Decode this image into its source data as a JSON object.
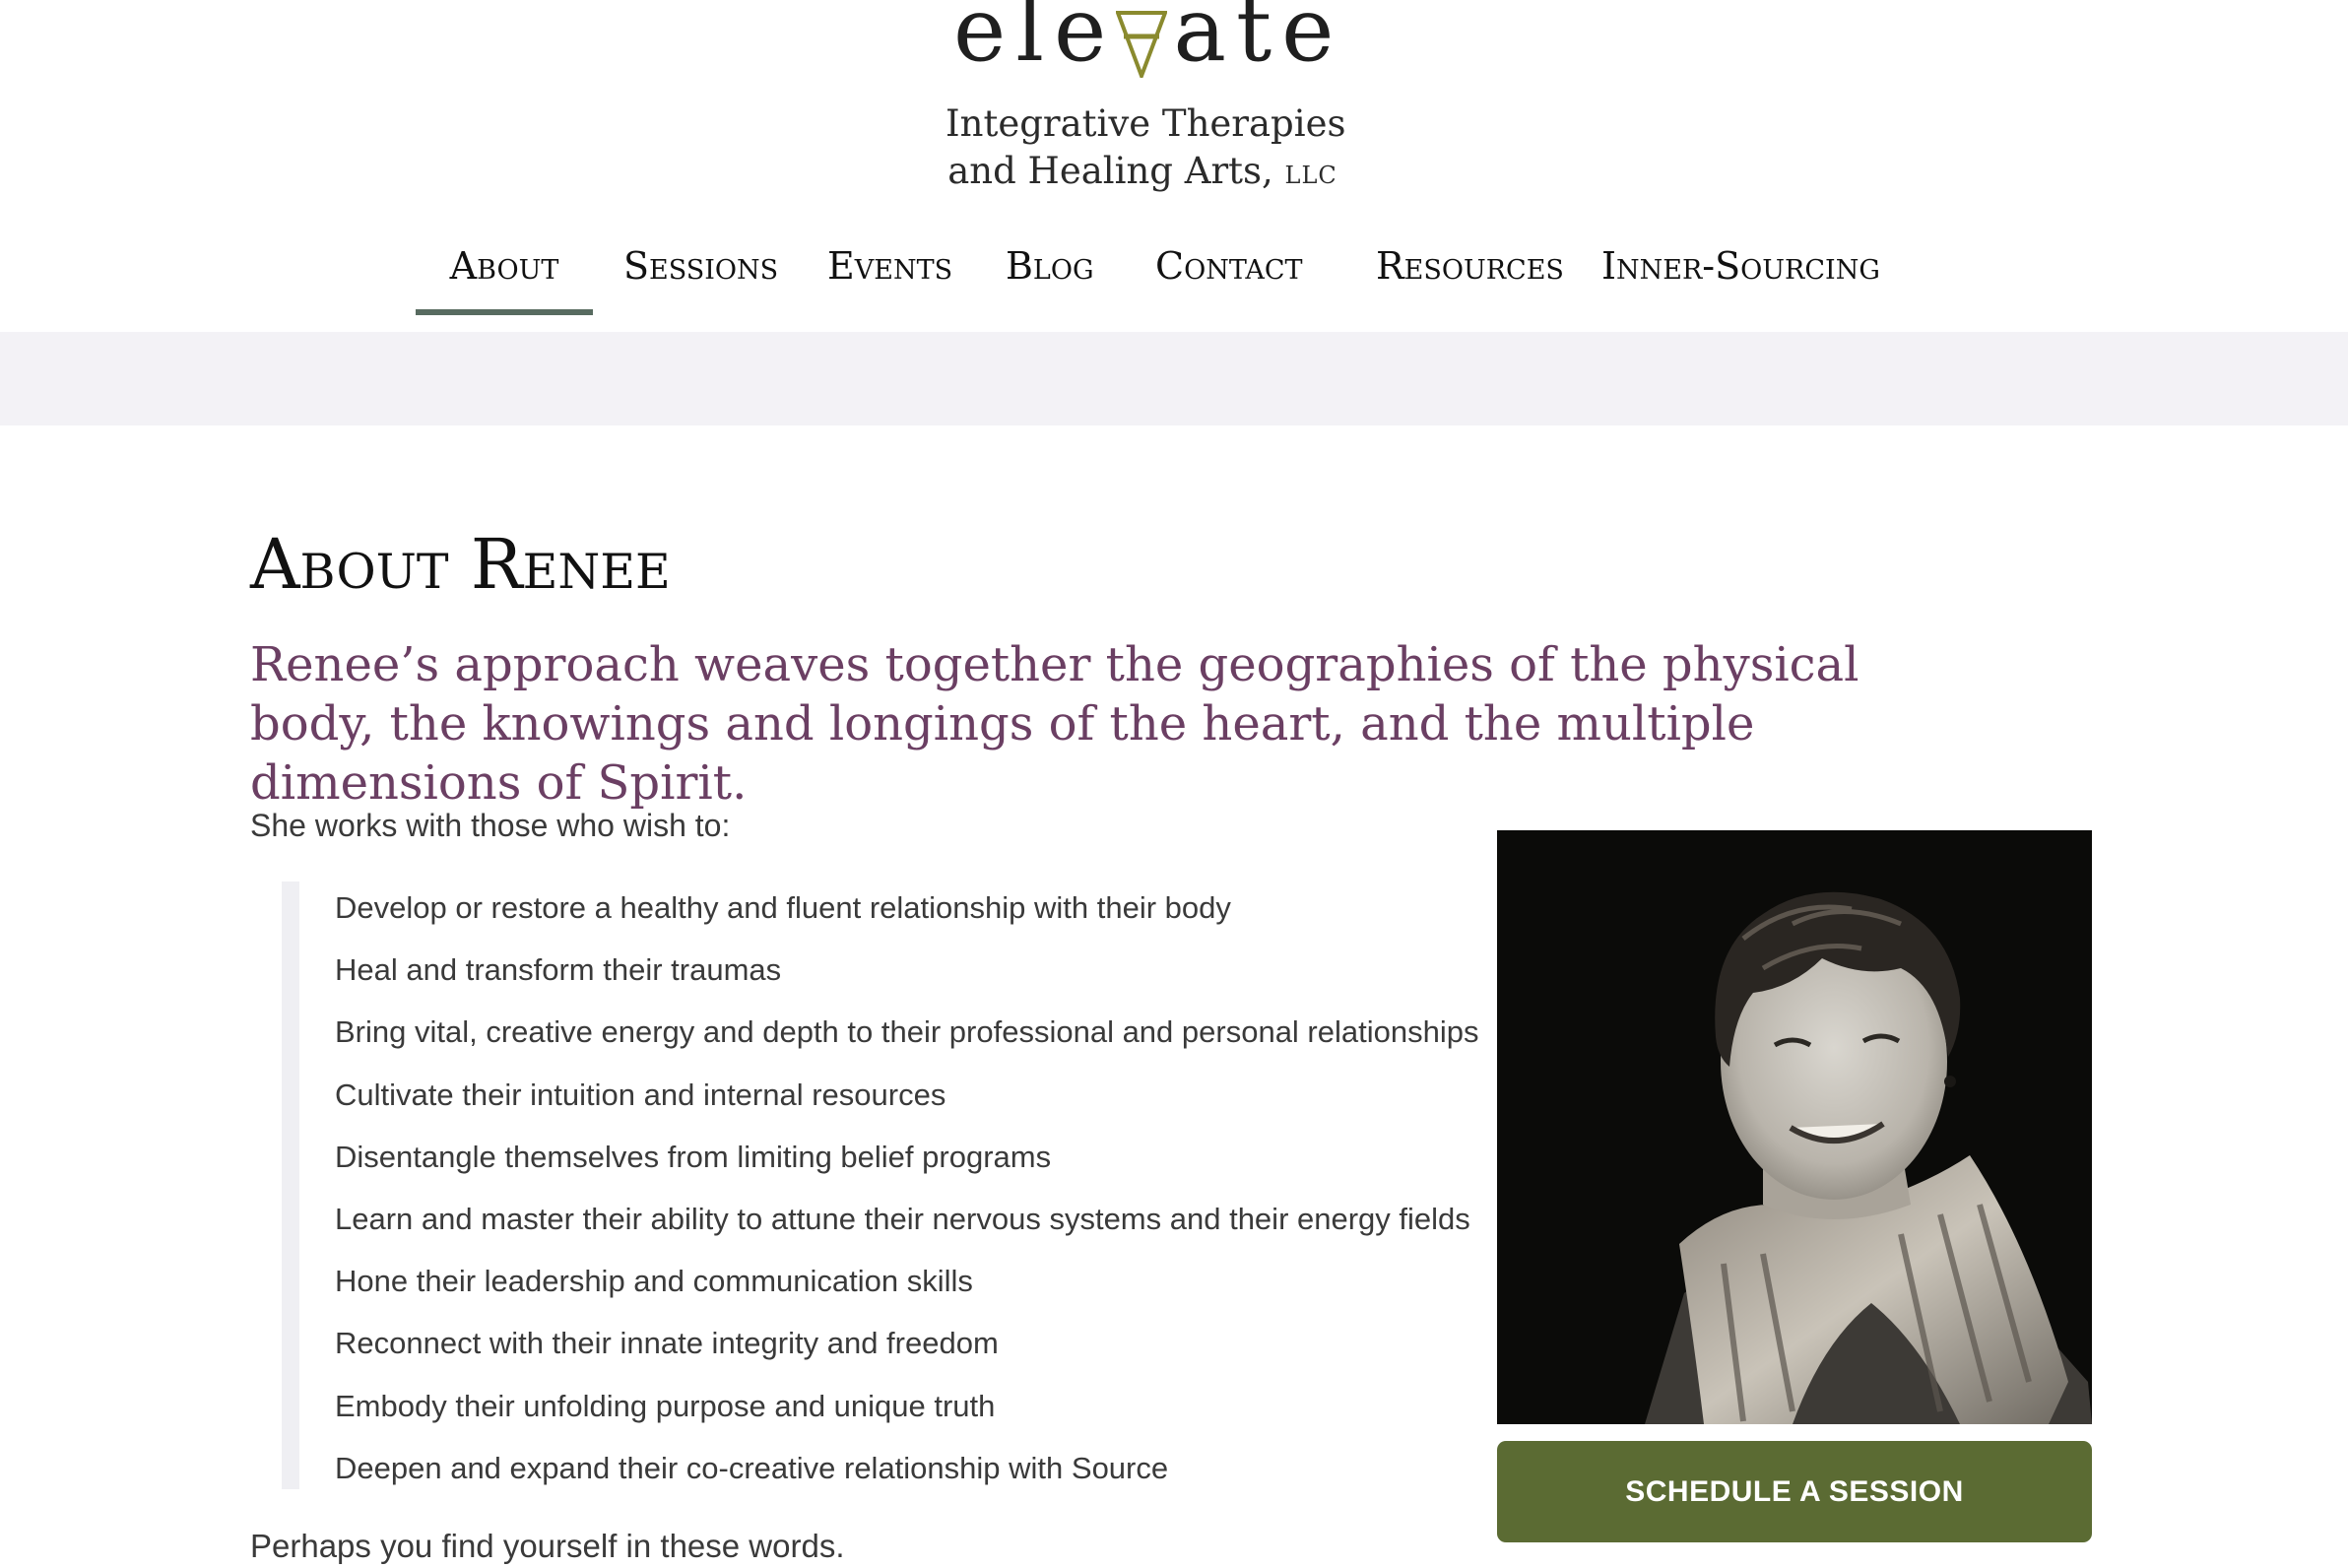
{
  "logo": {
    "wordmark_left": "ele",
    "wordmark_mark": "V",
    "wordmark_right": "ate",
    "tagline_line1": "Integrative Therapies",
    "tagline_line2": "and Healing Arts,",
    "tagline_suffix": "LLC",
    "accent_color": "#8a8a2e"
  },
  "nav": {
    "items": [
      {
        "label": "About",
        "active": true
      },
      {
        "label": "Sessions",
        "active": false
      },
      {
        "label": "Events",
        "active": false
      },
      {
        "label": "Blog",
        "active": false
      },
      {
        "label": "Contact",
        "active": false
      },
      {
        "label": "Resources",
        "active": false
      },
      {
        "label": "Inner-Sourcing",
        "active": false
      }
    ],
    "active_underline_color": "#586b60"
  },
  "main": {
    "title": "About Renee",
    "lead": "Renee’s approach weaves together the geographies of the physical body, the knowings and longings of the heart, and the multiple dimensions of Spirit.",
    "intro": "She works with those who wish to:",
    "bullets": [
      "Develop or restore a healthy and fluent relationship with their body",
      "Heal and transform their traumas",
      "Bring vital, creative energy and depth to their professional and personal relationships",
      "Cultivate their intuition and internal resources",
      "Disentangle themselves from limiting belief programs",
      "Learn and master their ability to attune their nervous systems and their energy fields",
      "Hone their leadership and communication skills",
      "Reconnect with their innate integrity and freedom",
      "Embody their unfolding purpose and unique truth",
      "Deepen and expand their co-creative relationship with Source"
    ],
    "outro": "Perhaps you find yourself in these words."
  },
  "sidebar": {
    "cta_label": "SCHEDULE A SESSION",
    "cta_color": "#5b6b33"
  },
  "colors": {
    "lead_text": "#6b3f63",
    "band": "#f3f2f6"
  }
}
